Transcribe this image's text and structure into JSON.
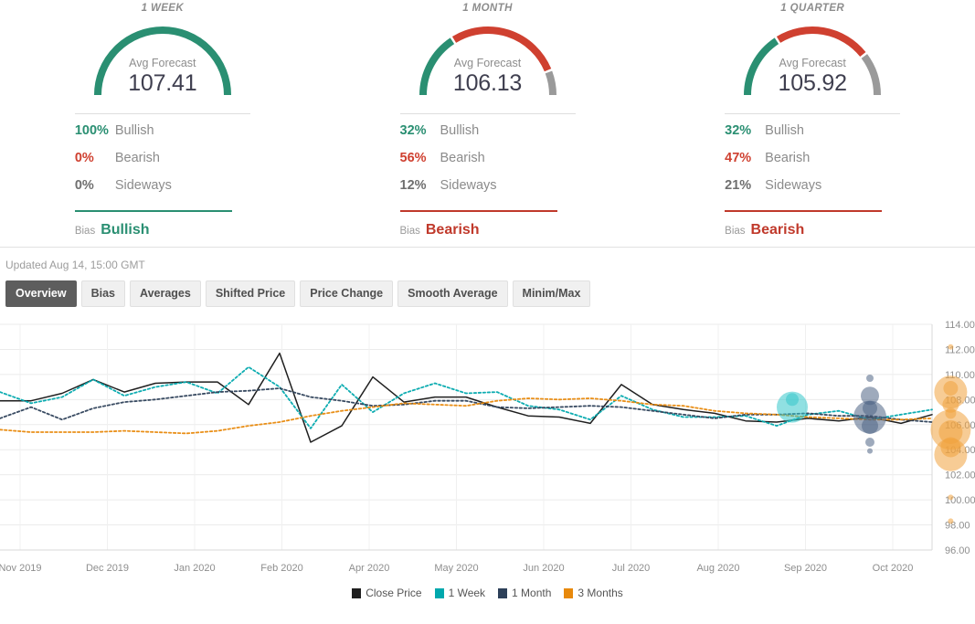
{
  "panels": [
    {
      "title": "1 WEEK",
      "gauge_label": "Avg Forecast",
      "gauge_value": "107.41",
      "bullish_pct": "100%",
      "bullish_label": "Bullish",
      "bearish_pct": "0%",
      "bearish_label": "Bearish",
      "sideways_pct": "0%",
      "sideways_label": "Sideways",
      "bias_label": "Bias",
      "bias_value": "Bullish",
      "bias_color": "#2a8f72",
      "arc": {
        "bullish": 100,
        "bearish": 0,
        "sideways": 0
      }
    },
    {
      "title": "1 MONTH",
      "gauge_label": "Avg Forecast",
      "gauge_value": "106.13",
      "bullish_pct": "32%",
      "bullish_label": "Bullish",
      "bearish_pct": "56%",
      "bearish_label": "Bearish",
      "sideways_pct": "12%",
      "sideways_label": "Sideways",
      "bias_label": "Bias",
      "bias_value": "Bearish",
      "bias_color": "#c0392b",
      "arc": {
        "bullish": 32,
        "bearish": 56,
        "sideways": 12
      }
    },
    {
      "title": "1 QUARTER",
      "gauge_label": "Avg Forecast",
      "gauge_value": "105.92",
      "bullish_pct": "32%",
      "bullish_label": "Bullish",
      "bearish_pct": "47%",
      "bearish_label": "Bearish",
      "sideways_pct": "21%",
      "sideways_label": "Sideways",
      "bias_label": "Bias",
      "bias_value": "Bearish",
      "bias_color": "#c0392b",
      "arc": {
        "bullish": 32,
        "bearish": 47,
        "sideways": 21
      }
    }
  ],
  "updated": "Updated Aug 14, 15:00 GMT",
  "tabs": [
    {
      "label": "Overview",
      "active": true
    },
    {
      "label": "Bias",
      "active": false
    },
    {
      "label": "Averages",
      "active": false
    },
    {
      "label": "Shifted Price",
      "active": false
    },
    {
      "label": "Price Change",
      "active": false
    },
    {
      "label": "Smooth Average",
      "active": false
    },
    {
      "label": "Minim/Max",
      "active": false
    }
  ],
  "colors": {
    "bullish": "#2a8f72",
    "bearish": "#cf4030",
    "sideways": "#9a9a9a",
    "close_price": "#1f1f1f",
    "one_week": "#00a8ad",
    "one_month": "#2d4059",
    "three_months": "#e8890c"
  },
  "chart_data": {
    "type": "line",
    "title": "",
    "xlabel": "",
    "ylabel": "",
    "ylim": [
      96.0,
      114.0
    ],
    "ytick_labels": [
      "114.00",
      "112.00",
      "110.00",
      "108.00",
      "106.00",
      "104.00",
      "102.00",
      "100.00",
      "98.00",
      "96.00"
    ],
    "ytick_values": [
      114.0,
      112.0,
      110.0,
      108.0,
      106.0,
      104.0,
      102.0,
      100.0,
      98.0,
      96.0
    ],
    "grid": true,
    "legend_position": "bottom",
    "xtick_labels": [
      "Nov 2019",
      "Dec 2019",
      "Jan 2020",
      "Feb 2020",
      "Apr 2020",
      "May 2020",
      "Jun 2020",
      "Jul 2020",
      "Aug 2020",
      "Sep 2020",
      "Oct 2020"
    ],
    "legend": [
      "Close Price",
      "1 Week",
      "1 Month",
      "3 Months"
    ],
    "series": [
      {
        "name": "Close Price",
        "color": "#1f1f1f",
        "style": "solid",
        "values": [
          107.9,
          107.9,
          108.5,
          109.6,
          108.6,
          109.3,
          109.4,
          109.4,
          107.6,
          111.7,
          104.6,
          105.9,
          109.8,
          107.8,
          108.2,
          108.2,
          107.4,
          106.7,
          106.6,
          106.1,
          109.2,
          107.6,
          107.2,
          106.9,
          106.3,
          106.2,
          106.5,
          106.3,
          106.6,
          106.1,
          106.8
        ]
      },
      {
        "name": "1 Week",
        "color": "#00a8ad",
        "style": "dotted",
        "values": [
          108.6,
          107.7,
          108.2,
          109.6,
          108.3,
          109.0,
          109.4,
          108.5,
          110.6,
          109.0,
          105.7,
          109.2,
          107.0,
          108.5,
          109.3,
          108.5,
          108.6,
          107.5,
          107.2,
          106.4,
          108.3,
          107.2,
          106.6,
          106.6,
          106.7,
          105.9,
          106.8,
          107.1,
          106.4,
          106.8,
          107.2
        ]
      },
      {
        "name": "1 Month",
        "color": "#2d4059",
        "style": "dotted",
        "values": [
          106.5,
          107.4,
          106.4,
          107.3,
          107.8,
          108.0,
          108.3,
          108.6,
          108.7,
          108.9,
          108.2,
          107.9,
          107.5,
          107.6,
          107.9,
          107.9,
          107.4,
          107.3,
          107.4,
          107.5,
          107.4,
          107.1,
          106.8,
          106.5,
          106.8,
          106.8,
          106.9,
          106.7,
          106.7,
          106.4,
          106.2
        ]
      },
      {
        "name": "3 Months",
        "color": "#e8890c",
        "style": "dotted",
        "values": [
          105.6,
          105.4,
          105.4,
          105.4,
          105.5,
          105.4,
          105.3,
          105.5,
          105.9,
          106.2,
          106.7,
          107.1,
          107.4,
          107.7,
          107.6,
          107.5,
          107.9,
          108.1,
          108.0,
          108.1,
          107.9,
          107.6,
          107.5,
          107.1,
          106.9,
          106.8,
          106.6,
          106.5,
          106.4,
          106.4,
          106.5
        ]
      }
    ],
    "bubbles": [
      {
        "series": "1 Week",
        "color": "#35c6cb",
        "x_label": "Aug 2020",
        "x_index": 25.5,
        "value": 107.4,
        "size": 17
      },
      {
        "series": "1 Week",
        "color": "#35c6cb",
        "x_label": "Aug 2020",
        "x_index": 25.5,
        "value": 108.0,
        "size": 7
      },
      {
        "series": "1 Month",
        "color": "#4e6585",
        "x_label": "Sep 2020",
        "x_index": 28.0,
        "value": 109.7,
        "size": 4
      },
      {
        "series": "1 Month",
        "color": "#4e6585",
        "x_label": "Sep 2020",
        "x_index": 28.0,
        "value": 108.3,
        "size": 10
      },
      {
        "series": "1 Month",
        "color": "#4e6585",
        "x_label": "Sep 2020",
        "x_index": 28.0,
        "value": 107.3,
        "size": 8
      },
      {
        "series": "1 Month",
        "color": "#4e6585",
        "x_label": "Sep 2020",
        "x_index": 28.0,
        "value": 106.6,
        "size": 18
      },
      {
        "series": "1 Month",
        "color": "#4e6585",
        "x_label": "Sep 2020",
        "x_index": 28.0,
        "value": 105.9,
        "size": 9
      },
      {
        "series": "1 Month",
        "color": "#4e6585",
        "x_label": "Sep 2020",
        "x_index": 28.0,
        "value": 104.6,
        "size": 5
      },
      {
        "series": "1 Month",
        "color": "#4e6585",
        "x_label": "Sep 2020",
        "x_index": 28.0,
        "value": 103.9,
        "size": 3
      },
      {
        "series": "3 Months",
        "color": "#f0a23e",
        "x_label": "Oct 2020",
        "x_index": 30.6,
        "value": 112.2,
        "size": 3
      },
      {
        "series": "3 Months",
        "color": "#f0a23e",
        "x_label": "Oct 2020",
        "x_index": 30.6,
        "value": 108.6,
        "size": 18
      },
      {
        "series": "3 Months",
        "color": "#f0a23e",
        "x_label": "Oct 2020",
        "x_index": 30.6,
        "value": 108.9,
        "size": 8
      },
      {
        "series": "3 Months",
        "color": "#f0a23e",
        "x_label": "Oct 2020",
        "x_index": 30.6,
        "value": 107.6,
        "size": 9
      },
      {
        "series": "3 Months",
        "color": "#f0a23e",
        "x_label": "Oct 2020",
        "x_index": 30.6,
        "value": 106.9,
        "size": 6
      },
      {
        "series": "3 Months",
        "color": "#f0a23e",
        "x_label": "Oct 2020",
        "x_index": 30.6,
        "value": 105.6,
        "size": 22
      },
      {
        "series": "3 Months",
        "color": "#f0a23e",
        "x_label": "Oct 2020",
        "x_index": 30.6,
        "value": 105.4,
        "size": 13
      },
      {
        "series": "3 Months",
        "color": "#f0a23e",
        "x_label": "Oct 2020",
        "x_index": 30.6,
        "value": 104.2,
        "size": 11
      },
      {
        "series": "3 Months",
        "color": "#f0a23e",
        "x_label": "Oct 2020",
        "x_index": 30.6,
        "value": 103.6,
        "size": 18
      },
      {
        "series": "3 Months",
        "color": "#f0a23e",
        "x_label": "Oct 2020",
        "x_index": 30.6,
        "value": 100.2,
        "size": 3
      },
      {
        "series": "3 Months",
        "color": "#f0a23e",
        "x_label": "Oct 2020",
        "x_index": 30.6,
        "value": 98.3,
        "size": 3
      }
    ]
  }
}
